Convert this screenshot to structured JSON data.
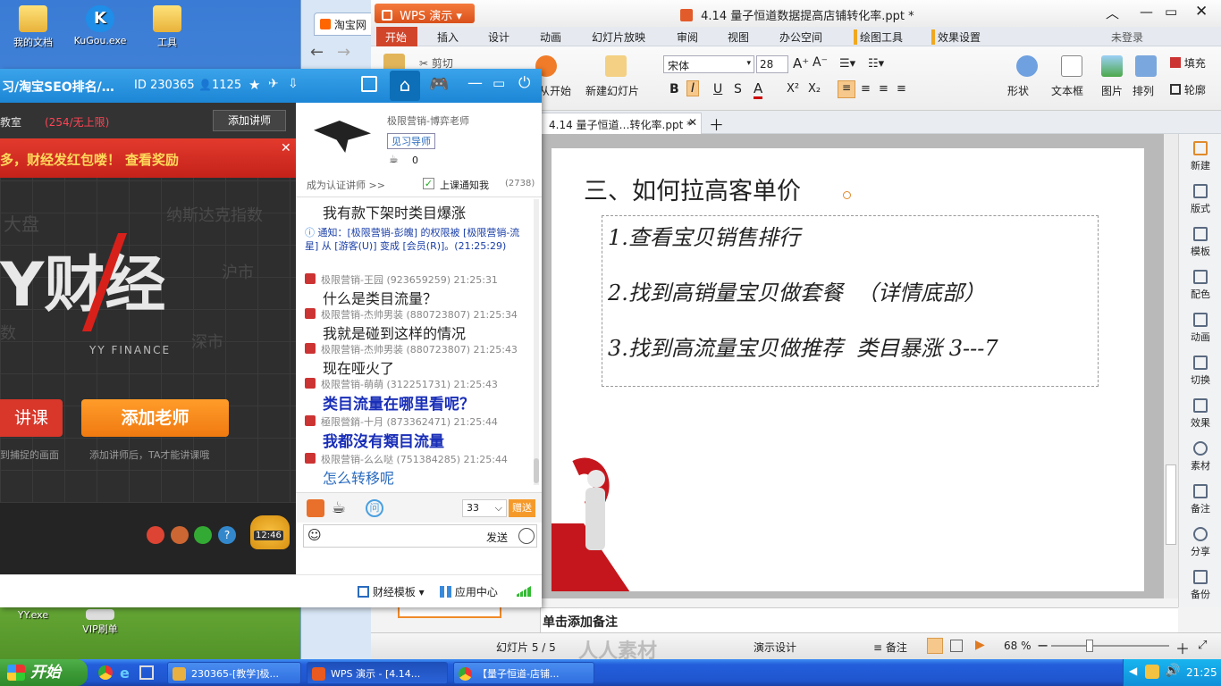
{
  "desktop": {
    "icons": [
      {
        "label": "我的文档"
      },
      {
        "label": "KuGou.exe"
      },
      {
        "label": "工具"
      },
      {
        "label": "YY.exe"
      },
      {
        "label": "VIP刷单"
      }
    ]
  },
  "browser": {
    "tab_label": "淘宝网"
  },
  "yy": {
    "title": "习/淘宝SEO排名/…",
    "room_id": "ID 230365",
    "user_count": "1125",
    "classroom_label": "教室",
    "queue_text": "(254/无上限)",
    "add_teacher_btn": "添加讲师",
    "banner_text": "多，财经发红包喽！",
    "banner_link": "查看奖励",
    "logo_text": "Y财经",
    "logo_sub": "YY FINANCE",
    "watermarks": [
      "大盘",
      "纳斯达克指数",
      "沪市",
      "数",
      "深市"
    ],
    "btn_left": "讲课",
    "btn_add_teacher": "添加老师",
    "caption_left": "到捕捉的画面",
    "caption_right": "添加讲师后，TA才能讲课哦",
    "time_badge": "12:46",
    "teacher_name": "极限营销-博弈老师",
    "teacher_role": "见习导师",
    "teacher_cups": "0",
    "become_teacher": "成为认证讲师 >>",
    "notify_label": "上课通知我",
    "notify_count": "(2738)",
    "messages": [
      {
        "meta": "",
        "text": "我有款下架时类目爆涨",
        "style": "normal"
      },
      {
        "meta": "",
        "text": "通知：[极限营销-彭魄] 的权限被 [极限营销-流星] 从 [游客(U)] 变成 [会员(R)]。(21:25:29)",
        "style": "notice"
      },
      {
        "meta": "极限营销-王园 (923659259) 21:25:31",
        "text": "什么是类目流量？",
        "style": "normal"
      },
      {
        "meta": "极限营销-杰帅男装 (880723807) 21:25:34",
        "text": "我就是碰到这样的情况",
        "style": "normal"
      },
      {
        "meta": "极限营销-杰帅男装 (880723807) 21:25:43",
        "text": "现在哑火了",
        "style": "normal"
      },
      {
        "meta": "极限营销-萌萌 (312251731) 21:25:43",
        "text": "类目流量在哪里看呢？",
        "style": "big"
      },
      {
        "meta": "極限營銷-十月 (873362471) 21:25:44",
        "text": "我都沒有類目流量",
        "style": "big"
      },
      {
        "meta": "极限营销-么么哒 (751384285) 21:25:44",
        "text": "怎么转移呢",
        "style": "blue"
      }
    ],
    "gift_count": "33",
    "gift_btn": "赠送",
    "send_btn": "发送",
    "footer_template": "财经模板",
    "footer_app": "应用中心"
  },
  "wps": {
    "app_label": "WPS 演示",
    "title": "4.14 量子恒道数据提高店铺转化率.ppt *",
    "login": "未登录",
    "menu": [
      "开始",
      "插入",
      "设计",
      "动画",
      "幻灯片放映",
      "审阅",
      "视图",
      "办公空间",
      "绘图工具",
      "效果设置"
    ],
    "ribbon": {
      "cut": "剪切",
      "start": "从开始",
      "new_slide": "新建幻灯片",
      "font": "宋体",
      "size": "28",
      "shape": "形状",
      "textbox": "文本框",
      "picture": "图片",
      "arrange": "排列",
      "fill": "填充",
      "outline": "轮廓"
    },
    "doc_tab": "4.14 量子恒道…转化率.ppt *",
    "slide": {
      "heading": "三、如何拉高客单价",
      "items": [
        "1.查看宝贝销售排行",
        "2.找到高销量宝贝做套餐  （详情底部）",
        "3.找到高流量宝贝做推荐  类目暴涨 3---7"
      ]
    },
    "side_panel": [
      "新建",
      "版式",
      "模板",
      "配色",
      "动画",
      "切换",
      "效果",
      "素材",
      "备注",
      "分享",
      "备份"
    ],
    "notes": "单击添加备注",
    "status": {
      "slide_pos": "幻灯片 5 / 5",
      "theme": "演示设计",
      "notes_btn": "备注",
      "zoom": "68 %",
      "watermark": "人人素材"
    }
  },
  "taskbar": {
    "start": "开始",
    "tasks": [
      "230365-[教学]极...",
      "WPS 演示 - [4.14...",
      "【量子恒道-店铺..."
    ],
    "clock": "21:25"
  }
}
